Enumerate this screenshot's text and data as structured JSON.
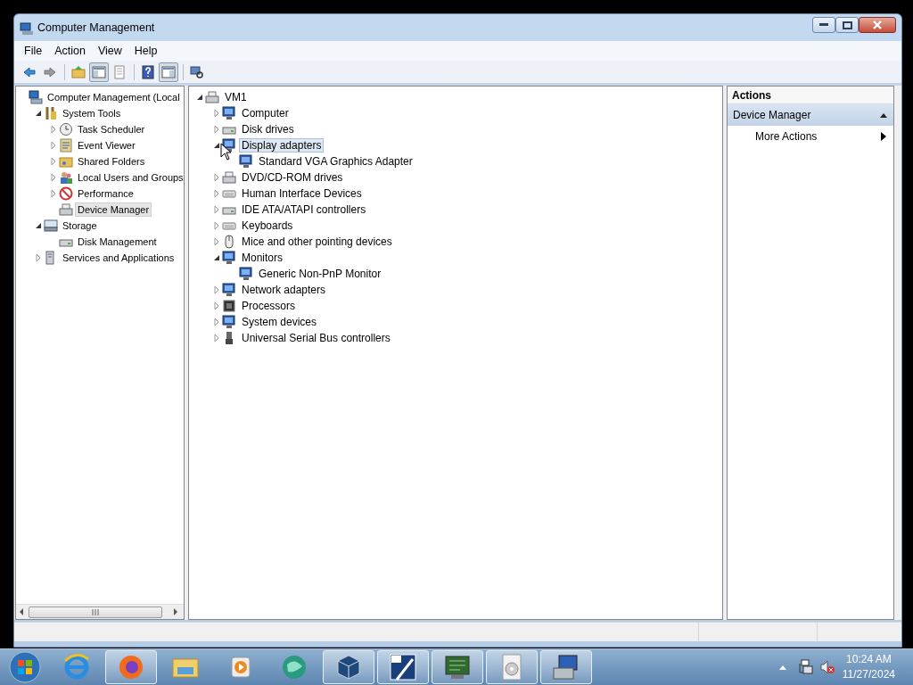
{
  "window": {
    "title": "Computer Management"
  },
  "menu": [
    "File",
    "Action",
    "View",
    "Help"
  ],
  "toolbar_groups": [
    {
      "buttons": [
        {
          "kind": "back",
          "pressed": false
        },
        {
          "kind": "forward",
          "pressed": false
        }
      ]
    },
    {
      "buttons": [
        {
          "kind": "up",
          "pressed": false
        },
        {
          "kind": "tree-pane",
          "pressed": true
        },
        {
          "kind": "list",
          "pressed": false
        }
      ]
    },
    {
      "buttons": [
        {
          "kind": "help",
          "pressed": false
        },
        {
          "kind": "action-pane",
          "pressed": true
        }
      ]
    },
    {
      "buttons": [
        {
          "kind": "scan",
          "pressed": false
        }
      ]
    }
  ],
  "console_tree": [
    {
      "label": "Computer Management (Local",
      "kind": "computer",
      "selected": false,
      "children": [
        {
          "label": "System Tools",
          "kind": "tools",
          "expanded": true,
          "selected": false,
          "children": [
            {
              "label": "Task Scheduler",
              "kind": "clock",
              "expanded": false,
              "selected": false
            },
            {
              "label": "Event Viewer",
              "kind": "log",
              "expanded": false,
              "selected": false
            },
            {
              "label": "Shared Folders",
              "kind": "folder",
              "expanded": false,
              "selected": false
            },
            {
              "label": "Local Users and Groups",
              "kind": "users",
              "expanded": false,
              "selected": false
            },
            {
              "label": "Performance",
              "kind": "perf",
              "expanded": false,
              "selected": false
            },
            {
              "label": "Device Manager",
              "kind": "printer",
              "selected": true
            }
          ]
        },
        {
          "label": "Storage",
          "kind": "storage",
          "expanded": true,
          "selected": false,
          "children": [
            {
              "label": "Disk Management",
              "kind": "disk",
              "selected": false
            }
          ]
        },
        {
          "label": "Services and Applications",
          "kind": "server",
          "expanded": false,
          "selected": false
        }
      ]
    }
  ],
  "device_tree": [
    {
      "label": "VM1",
      "kind": "printer",
      "expanded": true,
      "selected": false,
      "children": [
        {
          "label": "Computer",
          "kind": "monitor",
          "expanded": false,
          "selected": false
        },
        {
          "label": "Disk drives",
          "kind": "disk",
          "expanded": false,
          "selected": false
        },
        {
          "label": "Display adapters",
          "kind": "monitor",
          "expanded": true,
          "selected": true,
          "children": [
            {
              "label": "Standard VGA Graphics Adapter",
              "kind": "monitor",
              "selected": false
            }
          ]
        },
        {
          "label": "DVD/CD-ROM drives",
          "kind": "printer",
          "expanded": false,
          "selected": false
        },
        {
          "label": "Human Interface Devices",
          "kind": "keyboard",
          "expanded": false,
          "selected": false
        },
        {
          "label": "IDE ATA/ATAPI controllers",
          "kind": "disk",
          "expanded": false,
          "selected": false
        },
        {
          "label": "Keyboards",
          "kind": "keyboard",
          "expanded": false,
          "selected": false
        },
        {
          "label": "Mice and other pointing devices",
          "kind": "mouse",
          "expanded": false,
          "selected": false
        },
        {
          "label": "Monitors",
          "kind": "monitor",
          "expanded": true,
          "selected": false,
          "children": [
            {
              "label": "Generic Non-PnP Monitor",
              "kind": "monitor",
              "selected": false
            }
          ]
        },
        {
          "label": "Network adapters",
          "kind": "monitor",
          "expanded": false,
          "selected": false
        },
        {
          "label": "Processors",
          "kind": "chip",
          "expanded": false,
          "selected": false
        },
        {
          "label": "System devices",
          "kind": "monitor",
          "expanded": false,
          "selected": false
        },
        {
          "label": "Universal Serial Bus controllers",
          "kind": "usb",
          "expanded": false,
          "selected": false
        }
      ]
    }
  ],
  "actions": {
    "title": "Actions",
    "sections": [
      {
        "label": "Device Manager",
        "expanded": true,
        "items": [
          {
            "label": "More Actions",
            "submenu": true
          }
        ]
      }
    ]
  },
  "taskbar": {
    "apps": [
      {
        "kind": "ie",
        "running": false
      },
      {
        "kind": "firefox",
        "running": true
      },
      {
        "kind": "explorer",
        "running": false
      },
      {
        "kind": "media",
        "running": false
      },
      {
        "kind": "green",
        "running": false
      },
      {
        "kind": "box",
        "running": true
      },
      {
        "kind": "xp",
        "running": true
      },
      {
        "kind": "board",
        "running": true
      },
      {
        "kind": "cd",
        "running": true
      },
      {
        "kind": "devmgr",
        "running": true
      }
    ],
    "time": "10:24 AM",
    "date": "11/27/2024"
  }
}
